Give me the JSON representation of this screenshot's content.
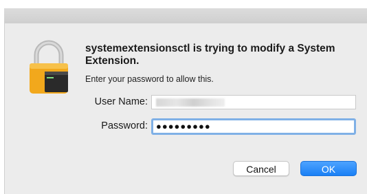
{
  "dialog": {
    "heading": "systemextensionsctl is trying to modify a System Extension.",
    "subtext": "Enter your password to allow this.",
    "icon": "lock-terminal-icon"
  },
  "form": {
    "username_label": "User Name:",
    "username_value": "",
    "password_label": "Password:",
    "password_value": "●●●●●●●●●"
  },
  "buttons": {
    "cancel_label": "Cancel",
    "ok_label": "OK"
  },
  "colors": {
    "accent": "#1a80f5",
    "focus_ring": "#7fb0e6",
    "dialog_bg": "#ececec"
  }
}
